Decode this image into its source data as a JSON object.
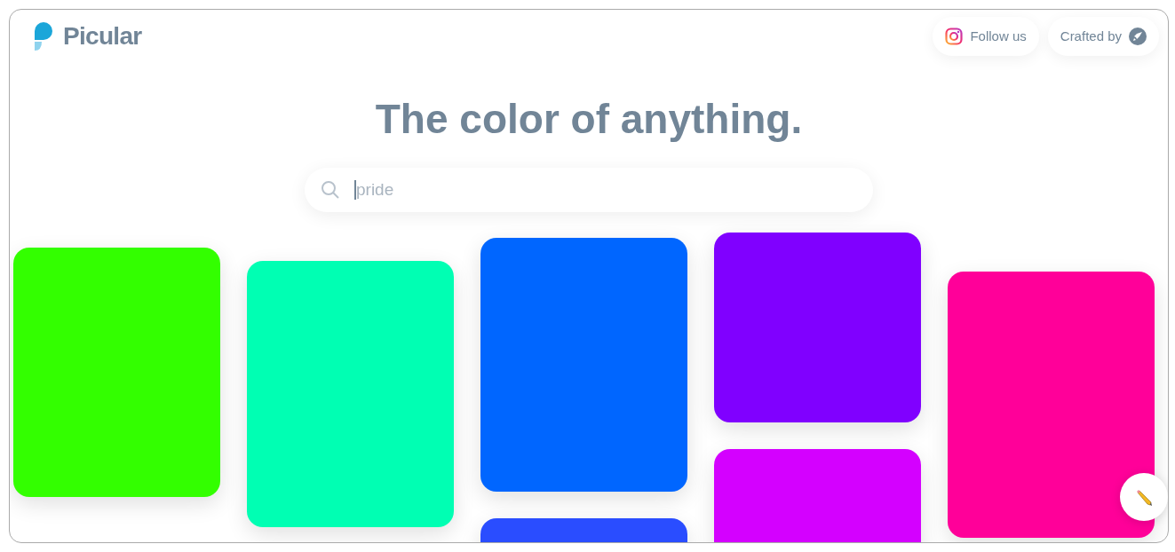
{
  "header": {
    "logo": "Picular",
    "links": [
      {
        "kind": "instagram",
        "label": "Follow us"
      },
      {
        "kind": "crafted",
        "label": "Crafted by"
      }
    ]
  },
  "headline": "The color of anything.",
  "search": {
    "placeholder": "pride"
  },
  "columns": [
    {
      "cards": [
        {
          "color": "#33ff00"
        }
      ]
    },
    {
      "cards": [
        {
          "color": "#00ffb3"
        }
      ]
    },
    {
      "cards": [
        {
          "color": "#0066ff"
        },
        {
          "color": "#2a4dff"
        }
      ]
    },
    {
      "cards": [
        {
          "color": "#8000ff"
        },
        {
          "color": "#d400ff"
        }
      ]
    },
    {
      "cards": [
        {
          "color": "#ff0099"
        }
      ]
    }
  ]
}
